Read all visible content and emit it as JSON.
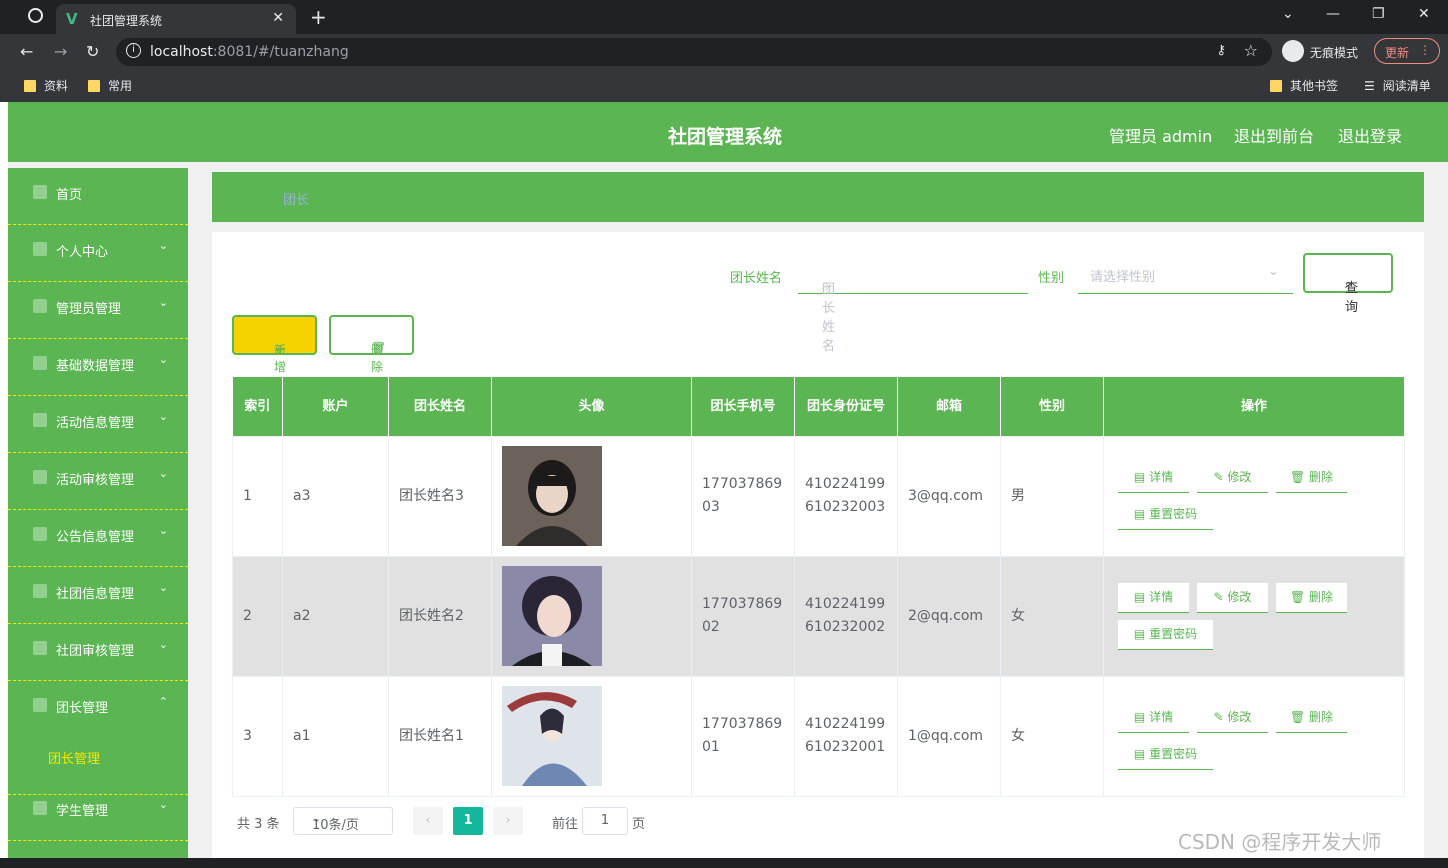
{
  "browser": {
    "tab_title": "社团管理系统",
    "url_host": "localhost",
    "url_rest": ":8081/#/tuanzhang",
    "incognito_label": "无痕模式",
    "update_label": "更新",
    "bookmarks": [
      "资料",
      "常用"
    ],
    "bookmarks_right": [
      "其他书签",
      "阅读清单"
    ]
  },
  "header": {
    "title": "社团管理系统",
    "admin": "管理员 admin",
    "to_front": "退出到前台",
    "logout": "退出登录"
  },
  "sidebar": {
    "items": [
      {
        "label": "首页",
        "chevron": ""
      },
      {
        "label": "个人中心",
        "chevron": "⌄"
      },
      {
        "label": "管理员管理",
        "chevron": "⌄"
      },
      {
        "label": "基础数据管理",
        "chevron": "⌄"
      },
      {
        "label": "活动信息管理",
        "chevron": "⌄"
      },
      {
        "label": "活动审核管理",
        "chevron": "⌄"
      },
      {
        "label": "公告信息管理",
        "chevron": "⌄"
      },
      {
        "label": "社团信息管理",
        "chevron": "⌄"
      },
      {
        "label": "社团审核管理",
        "chevron": "⌄"
      },
      {
        "label": "团长管理",
        "chevron": "⌃"
      },
      {
        "label": "学生管理",
        "chevron": "⌄"
      }
    ],
    "subitem": "团长管理"
  },
  "breadcrumb": "团长",
  "filters": {
    "name_label": "团长姓名",
    "name_placeholder": "团长姓名",
    "gender_label": "性别",
    "gender_placeholder": "请选择性别",
    "query_label": "查询"
  },
  "actions": {
    "add": "新增",
    "delete": "删除"
  },
  "table": {
    "columns": [
      "索引",
      "账户",
      "团长姓名",
      "头像",
      "团长手机号",
      "团长身份证号",
      "邮箱",
      "性别",
      "操作"
    ],
    "rows": [
      {
        "index": "1",
        "account": "a3",
        "name": "团长姓名3",
        "phone": "17703786903",
        "idcard": "410224199610232003",
        "email": "3@qq.com",
        "gender": "男"
      },
      {
        "index": "2",
        "account": "a2",
        "name": "团长姓名2",
        "phone": "17703786902",
        "idcard": "410224199610232002",
        "email": "2@qq.com",
        "gender": "女"
      },
      {
        "index": "3",
        "account": "a1",
        "name": "团长姓名1",
        "phone": "17703786901",
        "idcard": "410224199610232001",
        "email": "1@qq.com",
        "gender": "女"
      }
    ],
    "ops": {
      "detail": "详情",
      "edit": "修改",
      "delete": "删除",
      "reset": "重置密码"
    }
  },
  "pager": {
    "total": "共 3 条",
    "size": "10条/页",
    "current": "1",
    "goto": "前往",
    "goto_value": "1",
    "page": "页"
  },
  "watermark": "CSDN @程序开发大师",
  "colors": {
    "green": "#5ab552",
    "yellow": "#f5d200",
    "teal": "#13b89a"
  }
}
